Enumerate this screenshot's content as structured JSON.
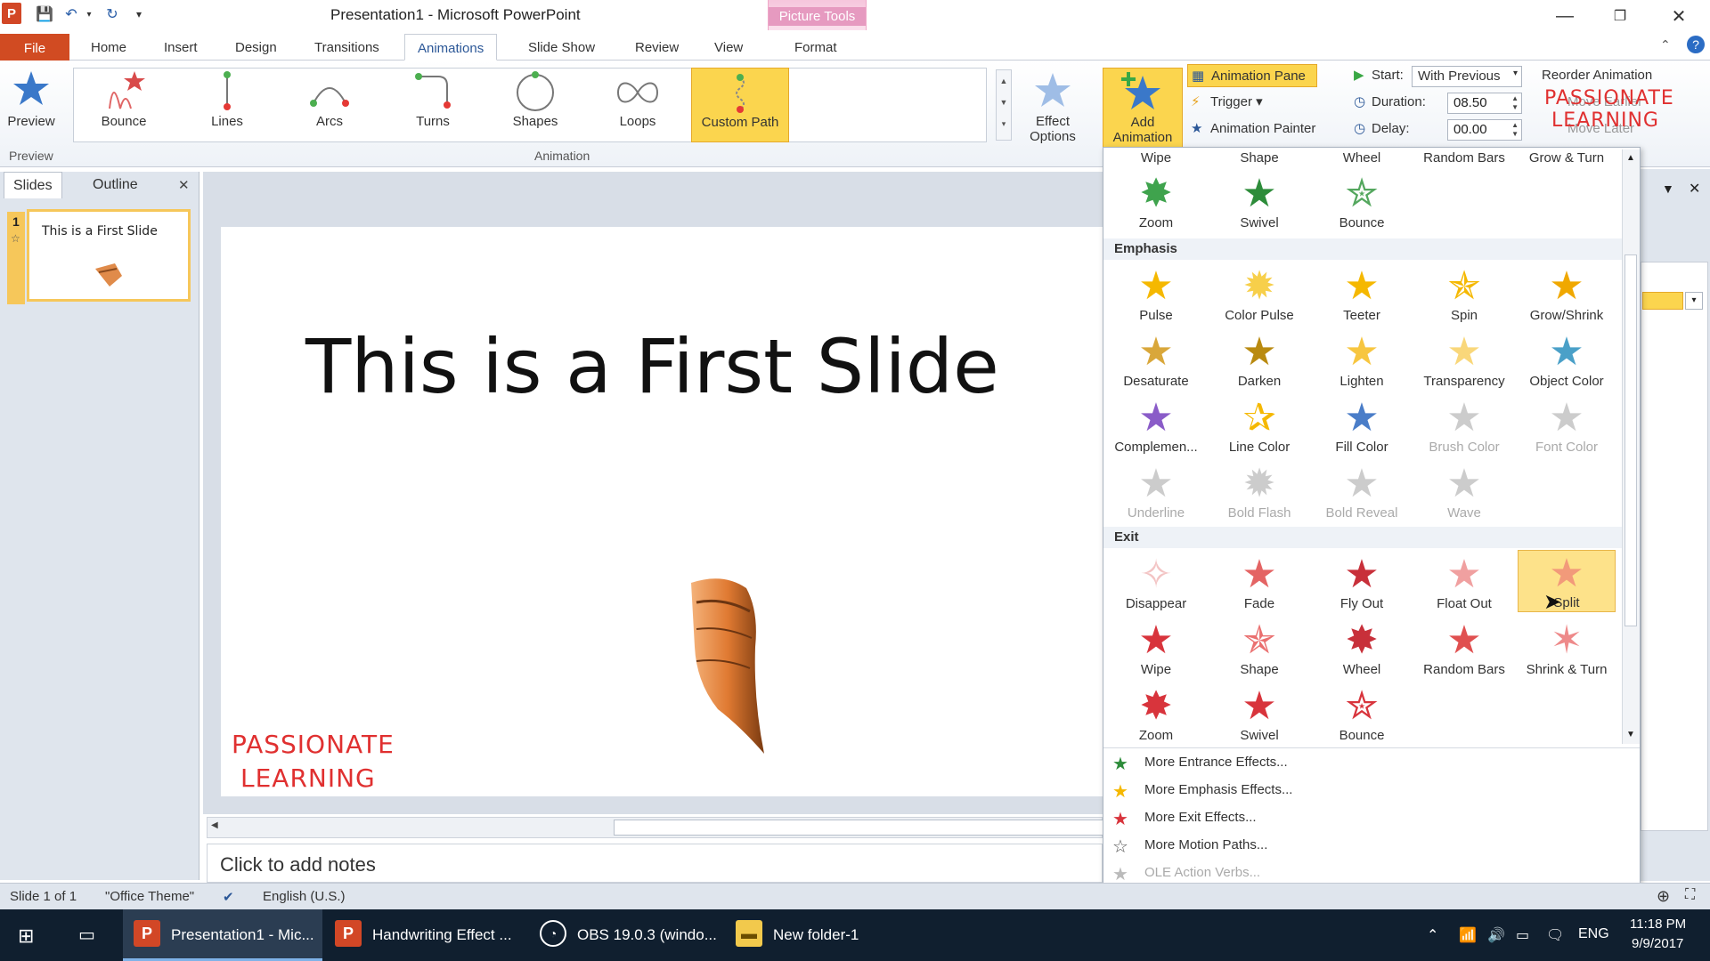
{
  "window": {
    "title": "Presentation1 - Microsoft PowerPoint",
    "contextual_tab_group": "Picture Tools",
    "controls": {
      "minimize": "—",
      "restore": "❐",
      "close": "✕"
    }
  },
  "quick_access": {
    "save_icon": "save-icon",
    "undo_icon": "undo-icon",
    "redo_icon": "redo-icon"
  },
  "tabs": [
    "File",
    "Home",
    "Insert",
    "Design",
    "Transitions",
    "Animations",
    "Slide Show",
    "Review",
    "View",
    "Format"
  ],
  "ribbon": {
    "preview": {
      "button": "Preview",
      "group_label": "Preview"
    },
    "animation_gallery": [
      "Bounce",
      "Lines",
      "Arcs",
      "Turns",
      "Shapes",
      "Loops",
      "Custom Path"
    ],
    "animation_group_label": "Animation",
    "effect_options": "Effect Options",
    "add_animation": "Add Animation",
    "animation_pane": "Animation Pane",
    "trigger": "Trigger",
    "animation_painter": "Animation Painter",
    "start_label": "Start:",
    "start_value": "With Previous",
    "duration_label": "Duration:",
    "duration_value": "08.50",
    "delay_label": "Delay:",
    "delay_value": "00.00",
    "reorder_label": "Reorder Animation",
    "move_earlier": "Move Earlier",
    "move_later": "Move Later"
  },
  "watermark": {
    "line1": "PASSIONATE",
    "line2": "LEARNING"
  },
  "left_pane": {
    "tabs": [
      "Slides",
      "Outline"
    ],
    "close": "✕",
    "thumb_number": "1",
    "thumb_title": "This is a First Slide"
  },
  "slide": {
    "title": "This is a First Slide"
  },
  "notes": {
    "placeholder": "Click to add notes"
  },
  "gallery": {
    "entrance_top_row": [
      "Wipe",
      "Shape",
      "Wheel",
      "Random Bars",
      "Grow & Turn"
    ],
    "entrance_row2": [
      "Zoom",
      "Swivel",
      "Bounce"
    ],
    "emphasis_heading": "Emphasis",
    "emphasis": [
      [
        "Pulse",
        "Color Pulse",
        "Teeter",
        "Spin",
        "Grow/Shrink"
      ],
      [
        "Desaturate",
        "Darken",
        "Lighten",
        "Transparency",
        "Object Color"
      ],
      [
        "Complemen...",
        "Line Color",
        "Fill Color",
        "Brush Color",
        "Font Color"
      ],
      [
        "Underline",
        "Bold Flash",
        "Bold Reveal",
        "Wave"
      ]
    ],
    "exit_heading": "Exit",
    "exit": [
      [
        "Disappear",
        "Fade",
        "Fly Out",
        "Float Out",
        "Split"
      ],
      [
        "Wipe",
        "Shape",
        "Wheel",
        "Random Bars",
        "Shrink & Turn"
      ],
      [
        "Zoom",
        "Swivel",
        "Bounce"
      ]
    ],
    "more": [
      "More Entrance Effects...",
      "More Emphasis Effects...",
      "More Exit Effects...",
      "More Motion Paths...",
      "OLE Action Verbs..."
    ]
  },
  "status_bar": {
    "slide": "Slide 1 of 1",
    "theme": "\"Office Theme\"",
    "language": "English (U.S.)"
  },
  "taskbar": {
    "items": [
      "Presentation1 - Mic...",
      "Handwriting Effect ...",
      "OBS 19.0.3 (windo...",
      "New folder-1"
    ],
    "lang": "ENG",
    "time": "11:18 PM",
    "date": "9/9/2017"
  },
  "colors": {
    "file_tab": "#d14b22",
    "selected": "#fbd54e",
    "accent": "#2b5797",
    "watermark": "#e03030"
  }
}
